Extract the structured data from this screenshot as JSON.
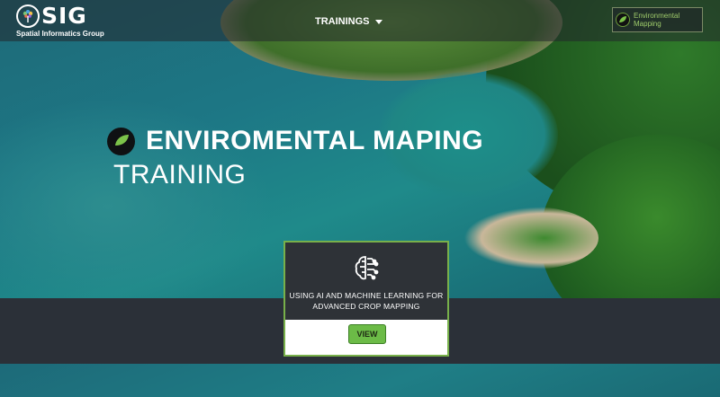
{
  "header": {
    "logo_text": "SIG",
    "logo_subtitle": "Spatial Informatics Group",
    "nav_trainings": "TRAININGS",
    "chip_line1": "Environmental",
    "chip_line2": "Mapping"
  },
  "hero": {
    "title": "ENVIROMENTAL MAPING",
    "subtitle": "TRAINING"
  },
  "card": {
    "title": "USING AI AND MACHINE LEARNING FOR ADVANCED CROP MAPPING",
    "view_label": "VIEW"
  },
  "colors": {
    "accent_green": "#6cbb47",
    "card_border": "#78b04a",
    "dark_band": "#2b3038"
  },
  "icons": [
    "sig-tree-logo-icon",
    "chevron-down-icon",
    "leaf-icon",
    "ai-brain-icon"
  ]
}
